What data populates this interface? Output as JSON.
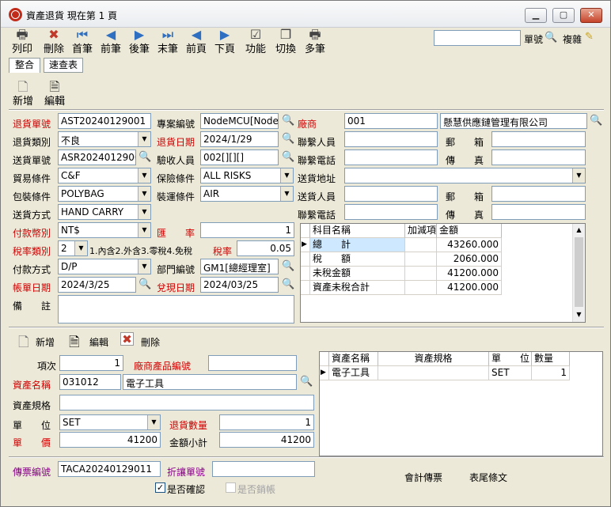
{
  "window": {
    "title": "資產退貨  現在第 1 頁",
    "min": "▁",
    "max": "▢",
    "close": "✕"
  },
  "toolbar": [
    {
      "label": "列印",
      "icon": "printer-icon",
      "glyph": "🖶"
    },
    {
      "label": "刪除",
      "icon": "delete-icon",
      "glyph": "✖"
    },
    {
      "label": "首筆",
      "icon": "first-record-icon",
      "glyph": "⏮"
    },
    {
      "label": "前筆",
      "icon": "prev-record-icon",
      "glyph": "◀"
    },
    {
      "label": "後筆",
      "icon": "next-record-icon",
      "glyph": "▶"
    },
    {
      "label": "末筆",
      "icon": "last-record-icon",
      "glyph": "⏭"
    },
    {
      "label": "前頁",
      "icon": "prev-page-icon",
      "glyph": "◀"
    },
    {
      "label": "下頁",
      "icon": "next-page-icon",
      "glyph": "▶"
    },
    {
      "label": "功能",
      "icon": "function-icon",
      "glyph": "☑"
    },
    {
      "label": "切換",
      "icon": "switch-icon",
      "glyph": "❐"
    },
    {
      "label": "多筆",
      "icon": "multi-record-icon",
      "glyph": "🖶"
    }
  ],
  "search": {
    "value": "",
    "label": "單號",
    "copy_label": "複雜"
  },
  "tabs": [
    "整合",
    "速查表"
  ],
  "sub_toolbar": {
    "new": "新增",
    "edit": "編輯"
  },
  "form": {
    "return_no_label": "退貨單號",
    "return_no": "AST20240129001",
    "project_no_label": "專案編號",
    "project_no": "NodeMCU[NodeMCU",
    "vendor_label": "廠商",
    "vendor_code": "001",
    "vendor_name": "懸慧供應鏈管理有限公司",
    "return_type_label": "退貨類別",
    "return_type": "不良",
    "return_date_label": "退貨日期",
    "return_date": "2024/1/29",
    "contact_label": "聯繫人員",
    "contact": "",
    "postal_label": "郵　　箱",
    "postal": "",
    "ship_no_label": "送貨單號",
    "ship_no": "ASR20240129002",
    "inspector_label": "驗收人員",
    "inspector": "002[][][]",
    "phone_label": "聯繫電話",
    "phone": "",
    "fax_label": "傳　　真",
    "fax": "",
    "trade_terms_label": "貿易條件",
    "trade_terms": "C&F",
    "insurance_label": "保險條件",
    "insurance": "ALL RISKS",
    "ship_addr_label": "送貨地址",
    "ship_addr": "",
    "packing_label": "包裝條件",
    "packing": "POLYBAG",
    "transport_label": "裝運條件",
    "transport": "AIR",
    "shipper_label": "送貨人員",
    "shipper": "",
    "postal2_label": "郵　　箱",
    "postal2": "",
    "ship_method_label": "送貨方式",
    "ship_method": "HAND CARRY",
    "phone2_label": "聯繫電話",
    "phone2": "",
    "fax2_label": "傳　　真",
    "fax2": "",
    "currency_label": "付款幣別",
    "currency": "NT$",
    "rate_label": "匯　　率",
    "rate": "1",
    "tax_type_label": "稅率類別",
    "tax_type": "2",
    "tax_type_desc": "1.內含2.外含3.零稅4.免稅",
    "tax_rate_label": "稅率",
    "tax_rate": "0.05",
    "pay_method_label": "付款方式",
    "pay_method": "D/P",
    "dept_label": "部門編號",
    "dept": "GM1[總經理室]",
    "bill_date_label": "帳單日期",
    "bill_date": "2024/3/25",
    "cash_date_label": "兌現日期",
    "cash_date": "2024/03/25",
    "remark_label": "備　　註",
    "remark": ""
  },
  "summary": {
    "headers": [
      "科目名稱",
      "加減項",
      "金額"
    ],
    "rows": [
      [
        "總　　計",
        "",
        "43260.000"
      ],
      [
        "稅　　額",
        "",
        "2060.000"
      ],
      [
        "未稅金額",
        "",
        "41200.000"
      ],
      [
        "資產未稅合計",
        "",
        "41200.000"
      ]
    ]
  },
  "detail_toolbar": {
    "new": "新增",
    "edit": "編輯",
    "delete": "刪除"
  },
  "detail": {
    "item_label": "項次",
    "item": "1",
    "vendor_prod_label": "廠商產品編號",
    "vendor_prod": "",
    "asset_name_label": "資產名稱",
    "asset_code": "031012",
    "asset_name": "電子工具",
    "asset_spec_label": "資產規格",
    "asset_spec": "",
    "unit_label": "單　　位",
    "unit": "SET",
    "qty_label": "退貨數量",
    "qty": "1",
    "price_label": "單　　價",
    "price": "41200",
    "subtotal_label": "金額小計",
    "subtotal": "41200"
  },
  "detail_grid": {
    "headers": [
      "資產名稱",
      "資產規格",
      "單　　位",
      "數量"
    ],
    "rows": [
      [
        "電子工具",
        "",
        "SET",
        "1"
      ]
    ]
  },
  "footer": {
    "invoice_label": "傳票編號",
    "invoice": "TACA20240129011",
    "discount_label": "折讓單號",
    "discount": "",
    "confirmed_label": "是否確認",
    "cancelled_label": "是否銷帳",
    "acct_label": "會計傳票",
    "tail_label": "表尾條文"
  }
}
